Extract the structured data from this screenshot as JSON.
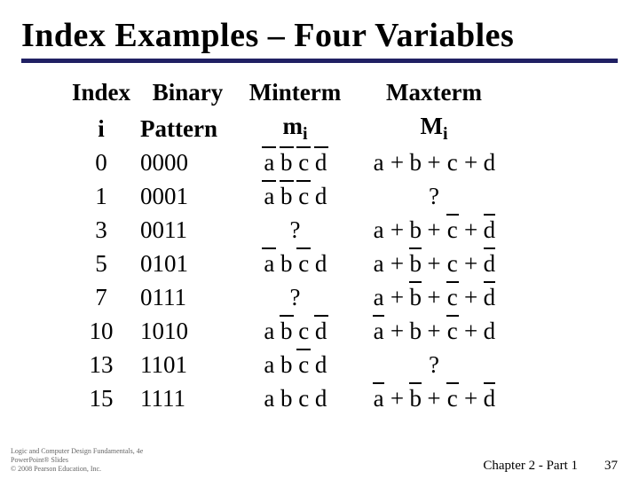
{
  "title": "Index Examples – Four Variables",
  "headers": {
    "index": "Index",
    "i": "i",
    "binary": "Binary",
    "pattern": "Pattern",
    "minterm": "Minterm",
    "m": "m",
    "m_sub": "i",
    "maxterm": "Maxterm",
    "M": "M",
    "M_sub": "i"
  },
  "vars": {
    "a": "a",
    "b": "b",
    "c": "c",
    "d": "d"
  },
  "q": "?",
  "plus": "+",
  "rows": [
    {
      "i": "0",
      "bin": "0000"
    },
    {
      "i": "1",
      "bin": "0001"
    },
    {
      "i": "3",
      "bin": "0011"
    },
    {
      "i": "5",
      "bin": "0101"
    },
    {
      "i": "7",
      "bin": "0111"
    },
    {
      "i": "10",
      "bin": "1010"
    },
    {
      "i": "13",
      "bin": "1101"
    },
    {
      "i": "15",
      "bin": "1111"
    }
  ],
  "chart_data": {
    "type": "table",
    "title": "Index Examples – Four Variables",
    "columns": [
      "Index i",
      "Binary Pattern",
      "Minterm m_i",
      "Maxterm M_i"
    ],
    "rows": [
      {
        "i": 0,
        "binary": "0000",
        "minterm": "a'b'c'd'",
        "maxterm": "a+b+c+d"
      },
      {
        "i": 1,
        "binary": "0001",
        "minterm": "a'b'c'd",
        "maxterm": "?"
      },
      {
        "i": 3,
        "binary": "0011",
        "minterm": "?",
        "maxterm": "a+b+c'+d'"
      },
      {
        "i": 5,
        "binary": "0101",
        "minterm": "a'bc'd",
        "maxterm": "a+b'+c+d'"
      },
      {
        "i": 7,
        "binary": "0111",
        "minterm": "?",
        "maxterm": "a+b'+c'+d'"
      },
      {
        "i": 10,
        "binary": "1010",
        "minterm": "ab'cd'",
        "maxterm": "a'+b+c'+d"
      },
      {
        "i": 13,
        "binary": "1101",
        "minterm": "abc'd",
        "maxterm": "?"
      },
      {
        "i": 15,
        "binary": "1111",
        "minterm": "abcd",
        "maxterm": "a'+b'+c'+d'"
      }
    ]
  },
  "footer": {
    "chapter": "Chapter 2 - Part 1",
    "page": "37"
  },
  "credits": {
    "l1": "Logic and Computer Design Fundamentals, 4e",
    "l2": "PowerPoint® Slides",
    "l3": "© 2008 Pearson Education, Inc."
  }
}
